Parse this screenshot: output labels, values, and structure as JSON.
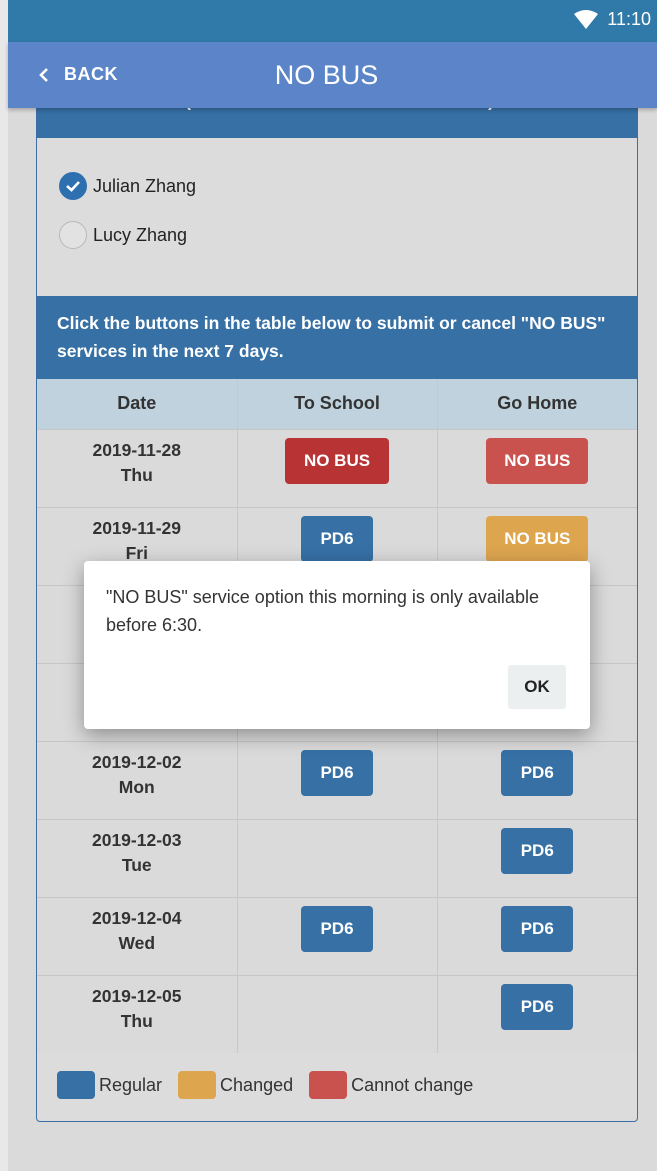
{
  "status": {
    "time": "11:10"
  },
  "header": {
    "back_label": "BACK",
    "title": "NO BUS"
  },
  "student_section": {
    "heading": "Select student (where there is more than one child)",
    "students": [
      {
        "name": "Julian Zhang",
        "checked": true
      },
      {
        "name": "Lucy Zhang",
        "checked": false
      }
    ]
  },
  "info": {
    "text": "Click the buttons in the table below to submit or cancel \"NO BUS\" services in the next 7 days."
  },
  "table": {
    "columns": [
      "Date",
      "To School",
      "Go Home"
    ],
    "rows": [
      {
        "date": "2019-11-28",
        "day": "Thu",
        "to_school": {
          "label": "NO BUS",
          "state": "cannot-active"
        },
        "go_home": {
          "label": "NO BUS",
          "state": "cannot"
        }
      },
      {
        "date": "2019-11-29",
        "day": "Fri",
        "to_school": {
          "label": "PD6",
          "state": "regular"
        },
        "go_home": {
          "label": "NO BUS",
          "state": "changed"
        }
      },
      {
        "date": "",
        "day": "",
        "to_school": null,
        "go_home": null
      },
      {
        "date": "",
        "day": "",
        "to_school": null,
        "go_home": null
      },
      {
        "date": "2019-12-02",
        "day": "Mon",
        "to_school": {
          "label": "PD6",
          "state": "regular"
        },
        "go_home": {
          "label": "PD6",
          "state": "regular"
        }
      },
      {
        "date": "2019-12-03",
        "day": "Tue",
        "to_school": null,
        "go_home": {
          "label": "PD6",
          "state": "regular"
        }
      },
      {
        "date": "2019-12-04",
        "day": "Wed",
        "to_school": {
          "label": "PD6",
          "state": "regular"
        },
        "go_home": {
          "label": "PD6",
          "state": "regular"
        }
      },
      {
        "date": "2019-12-05",
        "day": "Thu",
        "to_school": null,
        "go_home": {
          "label": "PD6",
          "state": "regular"
        }
      }
    ]
  },
  "legend": [
    {
      "label": "Regular",
      "color": "#3670a5"
    },
    {
      "label": "Changed",
      "color": "#dea54f"
    },
    {
      "label": "Cannot change",
      "color": "#c9524f"
    }
  ],
  "colors": {
    "regular": "#3670a5",
    "changed": "#dea54f",
    "cannot": "#c9524f",
    "cannot_active": "#b83434"
  },
  "dialog": {
    "message": "\"NO BUS\" service option this morning is only available before 6:30.",
    "ok_label": "OK"
  }
}
